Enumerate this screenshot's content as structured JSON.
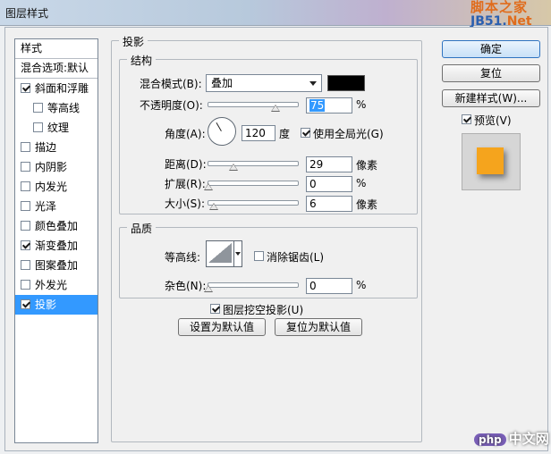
{
  "window": {
    "title": "图层样式"
  },
  "watermark": {
    "top": "脚本之家",
    "bottom_prefix": "JB51.",
    "bottom_suffix": "Net"
  },
  "style_list": {
    "header": "样式",
    "blend_options": "混合选项:默认",
    "items": [
      {
        "label": "斜面和浮雕",
        "checked": true,
        "indent": false,
        "selected": false
      },
      {
        "label": "等高线",
        "checked": false,
        "indent": true,
        "selected": false
      },
      {
        "label": "纹理",
        "checked": false,
        "indent": true,
        "selected": false
      },
      {
        "label": "描边",
        "checked": false,
        "indent": false,
        "selected": false
      },
      {
        "label": "内阴影",
        "checked": false,
        "indent": false,
        "selected": false
      },
      {
        "label": "内发光",
        "checked": false,
        "indent": false,
        "selected": false
      },
      {
        "label": "光泽",
        "checked": false,
        "indent": false,
        "selected": false
      },
      {
        "label": "颜色叠加",
        "checked": false,
        "indent": false,
        "selected": false
      },
      {
        "label": "渐变叠加",
        "checked": true,
        "indent": false,
        "selected": false
      },
      {
        "label": "图案叠加",
        "checked": false,
        "indent": false,
        "selected": false
      },
      {
        "label": "外发光",
        "checked": false,
        "indent": false,
        "selected": false
      },
      {
        "label": "投影",
        "checked": true,
        "indent": false,
        "selected": true
      }
    ]
  },
  "drop_shadow": {
    "title": "投影",
    "structure": {
      "title": "结构",
      "blend_mode_label": "混合模式(B):",
      "blend_mode_value": "叠加",
      "shadow_color": "#000000",
      "opacity_label": "不透明度(O):",
      "opacity_value": "75",
      "opacity_unit": "%",
      "angle_label": "角度(A):",
      "angle_value": "120",
      "angle_unit": "度",
      "global_light_label": "使用全局光(G)",
      "global_light_checked": true,
      "distance_label": "距离(D):",
      "distance_value": "29",
      "distance_unit": "像素",
      "spread_label": "扩展(R):",
      "spread_value": "0",
      "spread_unit": "%",
      "size_label": "大小(S):",
      "size_value": "6",
      "size_unit": "像素"
    },
    "quality": {
      "title": "品质",
      "contour_label": "等高线:",
      "anti_alias_label": "消除锯齿(L)",
      "anti_alias_checked": false,
      "noise_label": "杂色(N):",
      "noise_value": "0",
      "noise_unit": "%"
    },
    "knockout_label": "图层挖空投影(U)",
    "knockout_checked": true,
    "make_default_label": "设置为默认值",
    "reset_default_label": "复位为默认值"
  },
  "buttons": {
    "ok": "确定",
    "reset": "复位",
    "new_style": "新建样式(W)...",
    "preview_label": "预览(V)",
    "preview_checked": true
  },
  "colors": {
    "selected": "#3399ff",
    "preview_swatch": "#f5a41d"
  },
  "footer_logo": {
    "badge": "php",
    "text": "中文网"
  }
}
